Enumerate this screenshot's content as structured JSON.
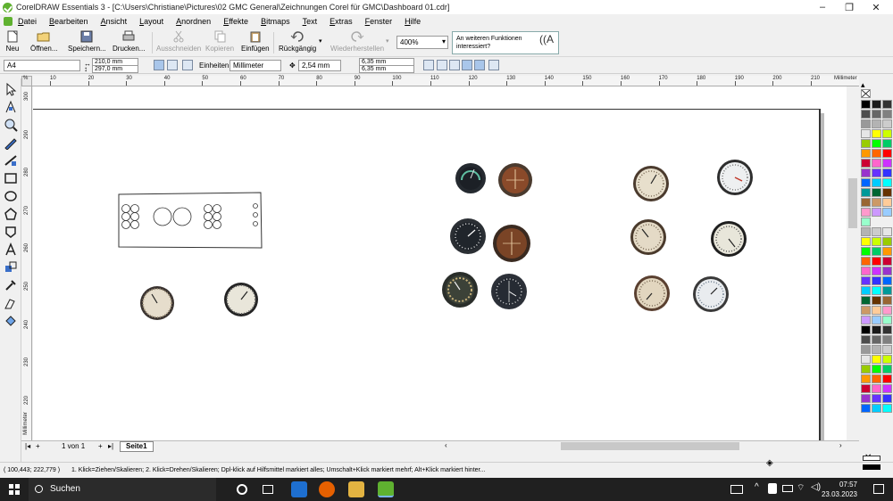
{
  "window": {
    "title": "CorelDRAW Essentials 3 - [C:\\Users\\Christiane\\Pictures\\02 GMC General\\Zeichnungen Corel für GMC\\Dashboard 01.cdr]",
    "minimize": "–",
    "maximize": "❐",
    "close": "✕"
  },
  "menu": [
    "Datei",
    "Bearbeiten",
    "Ansicht",
    "Layout",
    "Anordnen",
    "Effekte",
    "Bitmaps",
    "Text",
    "Extras",
    "Fenster",
    "Hilfe"
  ],
  "toolbar": {
    "new": "Neu",
    "open": "Öffnen...",
    "save": "Speichern...",
    "print": "Drucken...",
    "cut": "Ausschneiden",
    "copy": "Kopieren",
    "paste": "Einfügen",
    "undo": "Rückgängig",
    "redo": "Wiederherstellen",
    "zoom": "400%",
    "promo": "An weiteren Funktionen interessiert?"
  },
  "property_bar": {
    "page_size": "A4",
    "width": "210,0 mm",
    "height": "297,0 mm",
    "units_label": "Einheiten:",
    "units": "Millimeter",
    "nudge": "2,54 mm",
    "dup_x": "6,35 mm",
    "dup_y": "6,35 mm"
  },
  "ruler": {
    "h_labels": [
      "%",
      "10",
      "20",
      "30",
      "40",
      "50",
      "60",
      "70",
      "80",
      "90",
      "100",
      "110",
      "120",
      "130",
      "140",
      "150",
      "160",
      "170",
      "180",
      "190",
      "200",
      "210"
    ],
    "h_unit": "Millimeter",
    "v_labels": [
      "300",
      "290",
      "280",
      "270",
      "260",
      "250",
      "240",
      "230",
      "220"
    ],
    "v_unit": "Millimeter"
  },
  "pages": {
    "counter": "1 von 1",
    "tab": "Seite1"
  },
  "status": {
    "coords": "( 100,443; 222,779 )",
    "hint": "1. Klick=Ziehen/Skalieren; 2. Klick=Drehen/Skalieren; Dpl-klick auf Hilfsmittel markiert alles; Umschalt+Klick markiert mehrf; Alt+Klick markiert hinter..."
  },
  "taskbar": {
    "search": "Suchen",
    "time": "07:57",
    "date": "23.03.2023"
  },
  "palette_colors": [
    "#000000",
    "#1a1a1a",
    "#333333",
    "#4d4d4d",
    "#666666",
    "#808080",
    "#999999",
    "#b3b3b3",
    "#cccccc",
    "#e6e6e6",
    "#ffff00",
    "#ccff00",
    "#99cc00",
    "#00ff00",
    "#00cc66",
    "#ff9900",
    "#ff6600",
    "#ff0000",
    "#cc0033",
    "#ff66cc",
    "#cc33ff",
    "#9933cc",
    "#6633ff",
    "#3333ff",
    "#0066ff",
    "#00ccff",
    "#00ffff",
    "#009999",
    "#006633",
    "#663300",
    "#996633",
    "#cc9966",
    "#ffcc99",
    "#ff99cc",
    "#cc99ff",
    "#99ccff",
    "#99ffcc"
  ]
}
